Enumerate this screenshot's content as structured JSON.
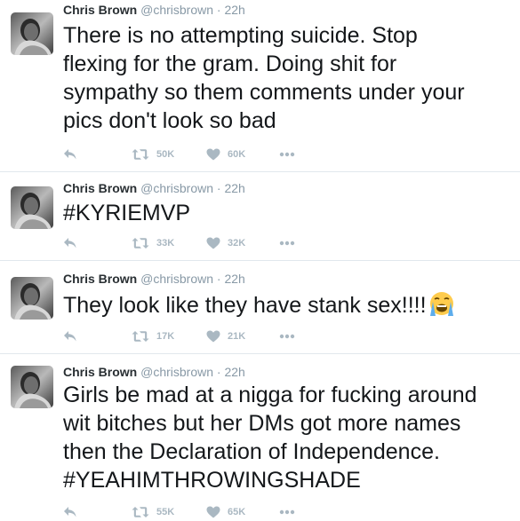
{
  "tweets": [
    {
      "name": "Chris Brown",
      "handle": "@chrisbrown",
      "dot": "·",
      "time": "22h",
      "lines": [
        "There is no attempting suicide. Stop",
        "flexing for the gram. Doing shit for",
        "sympathy so them comments under your",
        "pics don't look so bad"
      ],
      "retweets": "50K",
      "likes": "60K"
    },
    {
      "name": "Chris Brown",
      "handle": "@chrisbrown",
      "dot": "·",
      "time": "22h",
      "lines": [
        "#KYRIEMVP"
      ],
      "retweets": "33K",
      "likes": "32K"
    },
    {
      "name": "Chris Brown",
      "handle": "@chrisbrown",
      "dot": "·",
      "time": "22h",
      "lines": [
        "They look like they have stank sex!!!!"
      ],
      "emoji": "crying-face",
      "retweets": "17K",
      "likes": "21K"
    },
    {
      "name": "Chris Brown",
      "handle": "@chrisbrown",
      "dot": "·",
      "time": "22h",
      "lines": [
        "Girls be mad at a nigga for fucking around",
        "wit bitches but her DMs got more names",
        "then the Declaration of Independence.",
        "#YEAHIMTHROWINGSHADE"
      ],
      "retweets": "55K",
      "likes": "65K"
    }
  ],
  "icons": {
    "reply": "reply-icon",
    "retweet": "retweet-icon",
    "like": "heart-icon",
    "more": "more-icon"
  },
  "colors": {
    "action_icon": "#aab8c2",
    "meta": "#8899a6",
    "divider": "#e1e8ed"
  }
}
